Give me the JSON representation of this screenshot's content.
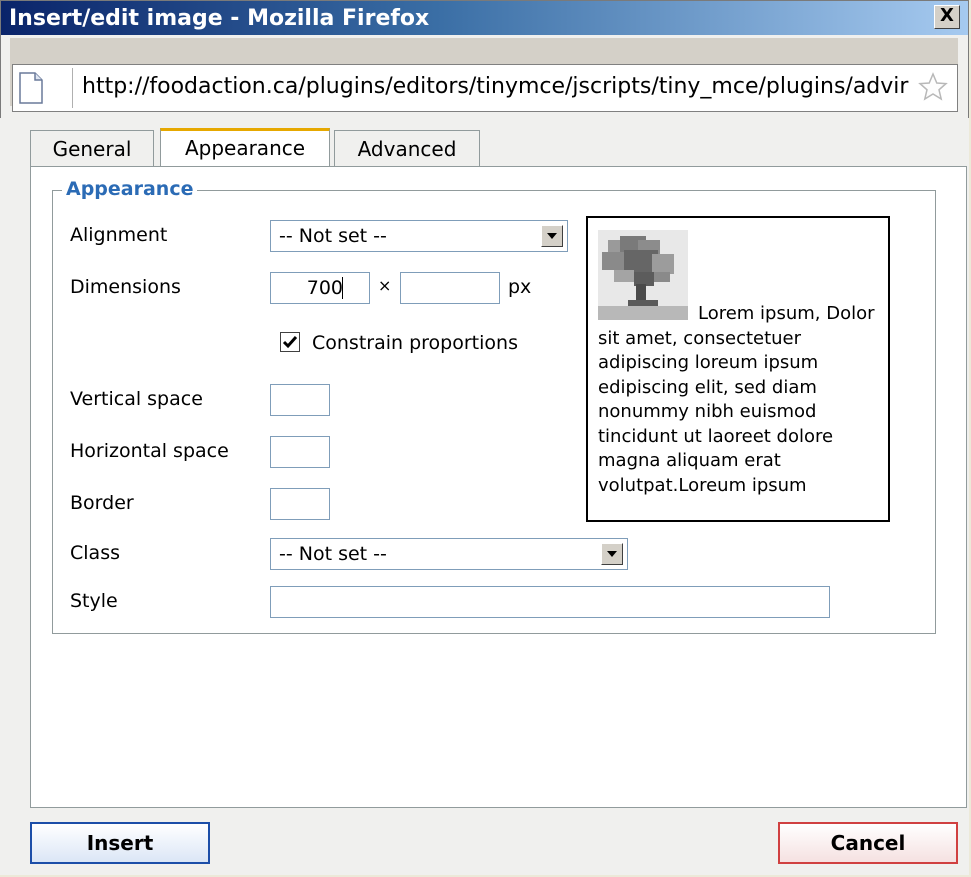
{
  "window": {
    "title": "Insert/edit image - Mozilla Firefox",
    "close_label": "X"
  },
  "addressbar": {
    "url": "http://foodaction.ca/plugins/editors/tinymce/jscripts/tiny_mce/plugins/advir",
    "page_icon": "page-icon",
    "bookmark_icon": "star-icon"
  },
  "tabs": [
    {
      "label": "General",
      "active": false
    },
    {
      "label": "Appearance",
      "active": true
    },
    {
      "label": "Advanced",
      "active": false
    }
  ],
  "appearance": {
    "legend": "Appearance",
    "alignment": {
      "label": "Alignment",
      "value": "-- Not set --"
    },
    "dimensions": {
      "label": "Dimensions",
      "width": "700",
      "height": "",
      "separator": "×",
      "unit": "px"
    },
    "constrain": {
      "label": "Constrain proportions",
      "checked": true
    },
    "vertical_space": {
      "label": "Vertical space",
      "value": ""
    },
    "horizontal_space": {
      "label": "Horizontal space",
      "value": ""
    },
    "border": {
      "label": "Border",
      "value": ""
    },
    "class": {
      "label": "Class",
      "value": "-- Not set --"
    },
    "style": {
      "label": "Style",
      "value": ""
    },
    "preview_text": "Lorem ipsum, Dolor sit amet, consectetuer adipiscing loreum ipsum edipiscing elit, sed diam nonummy nibh euismod tincidunt ut laoreet dolore magna aliquam erat volutpat.Loreum ipsum"
  },
  "buttons": {
    "insert": "Insert",
    "cancel": "Cancel"
  },
  "colors": {
    "accent": "#2b6bb5",
    "active_tab": "#e6a800",
    "insert_border": "#1c4ea8",
    "cancel_border": "#d04040"
  }
}
